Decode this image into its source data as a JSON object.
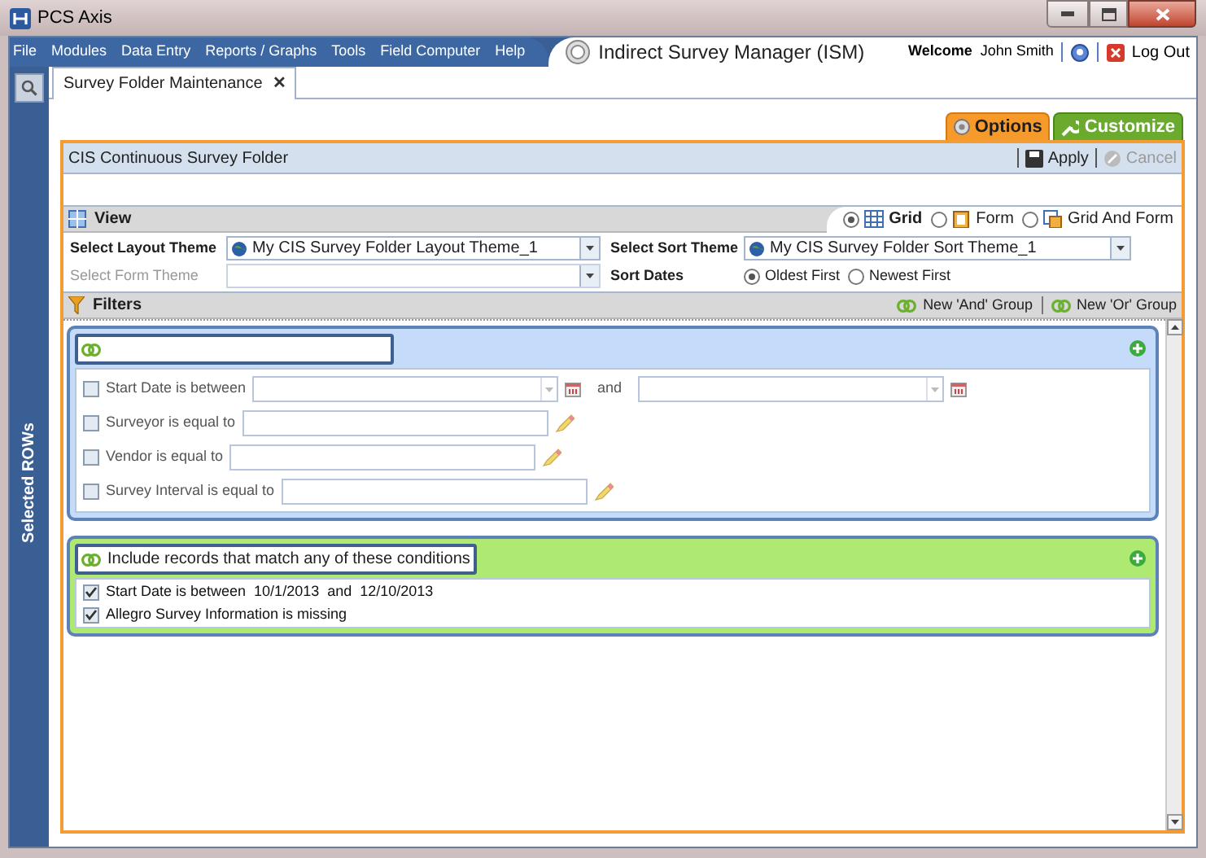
{
  "window": {
    "title": "PCS Axis"
  },
  "menu": [
    "File",
    "Modules",
    "Data Entry",
    "Reports / Graphs",
    "Tools",
    "Field Computer",
    "Help"
  ],
  "app_title": "Indirect Survey Manager (ISM)",
  "user": {
    "welcome": "Welcome",
    "name": "John Smith",
    "logout": "Log Out"
  },
  "sidebar": {
    "label": "Selected ROWs"
  },
  "tabs": [
    {
      "label": "Survey Folder Maintenance",
      "selected": true,
      "close": "✕"
    }
  ],
  "panel_tabs": [
    {
      "label": "Options",
      "kind": "options"
    },
    {
      "label": "Customize",
      "kind": "customize"
    }
  ],
  "folder": {
    "title": "CIS Continuous Survey Folder",
    "actions": [
      {
        "label": "Apply",
        "disabled": false
      },
      {
        "label": "Cancel",
        "disabled": true
      }
    ]
  },
  "view": {
    "title": "View",
    "modes": [
      {
        "label": "Grid",
        "kind": "grid",
        "selected": true
      },
      {
        "label": "Form",
        "kind": "form",
        "selected": false
      },
      {
        "label": "Grid And Form",
        "kind": "gridform",
        "selected": false
      }
    ],
    "layout_theme": {
      "label": "Select Layout Theme",
      "value": "My CIS Survey Folder Layout Theme_1",
      "disabled": false
    },
    "form_theme": {
      "label": "Select Form Theme",
      "disabled": true
    },
    "sort_theme": {
      "label": "Select Sort Theme",
      "value": "My CIS Survey Folder Sort Theme_1",
      "disabled": false
    },
    "sort_dates": {
      "label": "Sort Dates",
      "options": [
        {
          "label": "Oldest First",
          "selected": true
        },
        {
          "label": "Newest First",
          "selected": false
        }
      ]
    }
  },
  "filters": {
    "title": "Filters",
    "actions": [
      "New 'And' Group",
      "New 'Or' Group"
    ],
    "groups": [
      {
        "kind": "and",
        "conditions": [
          {
            "kind": "date_range",
            "label": "Start Date is between",
            "and_label": "and",
            "checked": false
          },
          {
            "kind": "text",
            "label": "Surveyor is equal to",
            "checked": false
          },
          {
            "kind": "text",
            "label": "Vendor is equal to",
            "checked": false
          },
          {
            "kind": "text",
            "label": "Survey Interval is equal to",
            "checked": false
          }
        ]
      },
      {
        "kind": "or",
        "name": "Include records that match any of these conditions",
        "conditions": [
          {
            "kind": "summary",
            "label": "Start Date is between  10/1/2013  and  12/10/2013",
            "checked": true
          },
          {
            "kind": "summary",
            "label": "Allegro Survey Information is missing",
            "checked": true
          }
        ]
      }
    ]
  }
}
